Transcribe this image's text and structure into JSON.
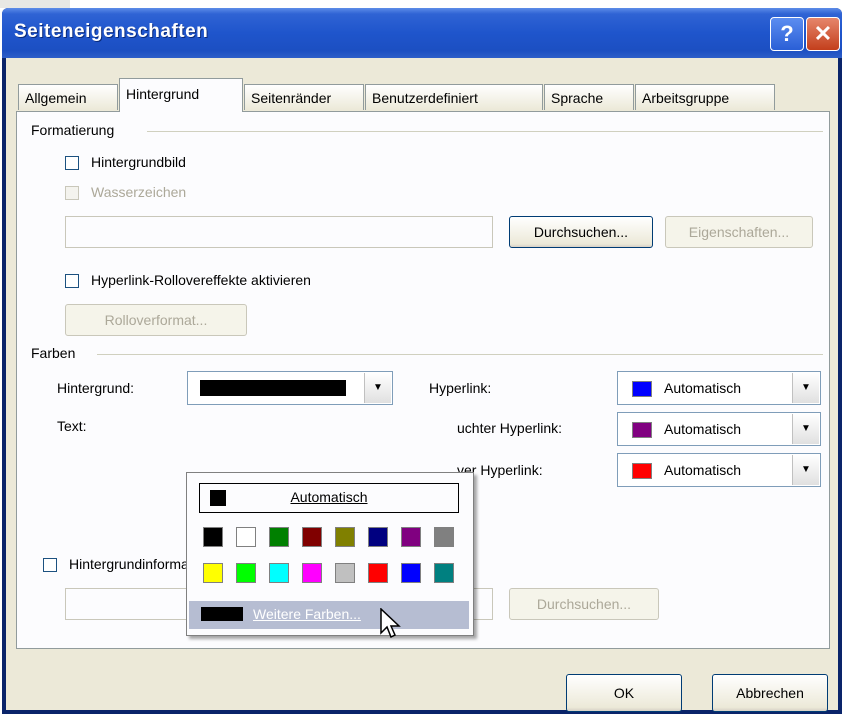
{
  "window": {
    "title": "Seiteneigenschaften",
    "help_glyph": "?",
    "close_glyph": "✕"
  },
  "tabs": [
    {
      "label": "Allgemein"
    },
    {
      "label": "Hintergrund",
      "active": true
    },
    {
      "label": "Seitenränder"
    },
    {
      "label": "Benutzerdefiniert"
    },
    {
      "label": "Sprache"
    },
    {
      "label": "Arbeitsgruppe"
    }
  ],
  "formatting": {
    "group_label": "Formatierung",
    "background_image_label": "Hintergrundbild",
    "watermark_label": "Wasserzeichen",
    "browse_label": "Durchsuchen...",
    "properties_label": "Eigenschaften...",
    "rollover_label": "Hyperlink-Rollovereffekte aktivieren",
    "rollover_format_label": "Rolloverformat..."
  },
  "colors": {
    "group_label": "Farben",
    "background_label": "Hintergrund:",
    "background_value_color": "#000000",
    "text_label": "Text:",
    "hyperlink_label": "Hyperlink:",
    "visited_label": "uchter Hyperlink:",
    "active_label": "ver Hyperlink:",
    "hyperlink_value": "Automatisch",
    "visited_value": "Automatisch",
    "active_value": "Automatisch",
    "hyperlink_color": "#0000ff",
    "visited_color": "#800080",
    "active_color": "#ff0000"
  },
  "color_popup": {
    "automatic_label": "Automatisch",
    "more_colors_label": "Weitere Farben...",
    "palette": [
      [
        "#000000",
        "#ffffff",
        "#008000",
        "#800000",
        "#808000",
        "#000080",
        "#800080",
        "#808080"
      ],
      [
        "#ffff00",
        "#00ff00",
        "#00ffff",
        "#ff00ff",
        "#c0c0c0",
        "#ff0000",
        "#0000ff",
        "#008080"
      ]
    ]
  },
  "inherit": {
    "label": "Hintergrundinformationen von einer anderen Seite übernehmen:",
    "browse_label": "Durchsuchen..."
  },
  "footer": {
    "ok_label": "OK",
    "cancel_label": "Abbrechen"
  }
}
